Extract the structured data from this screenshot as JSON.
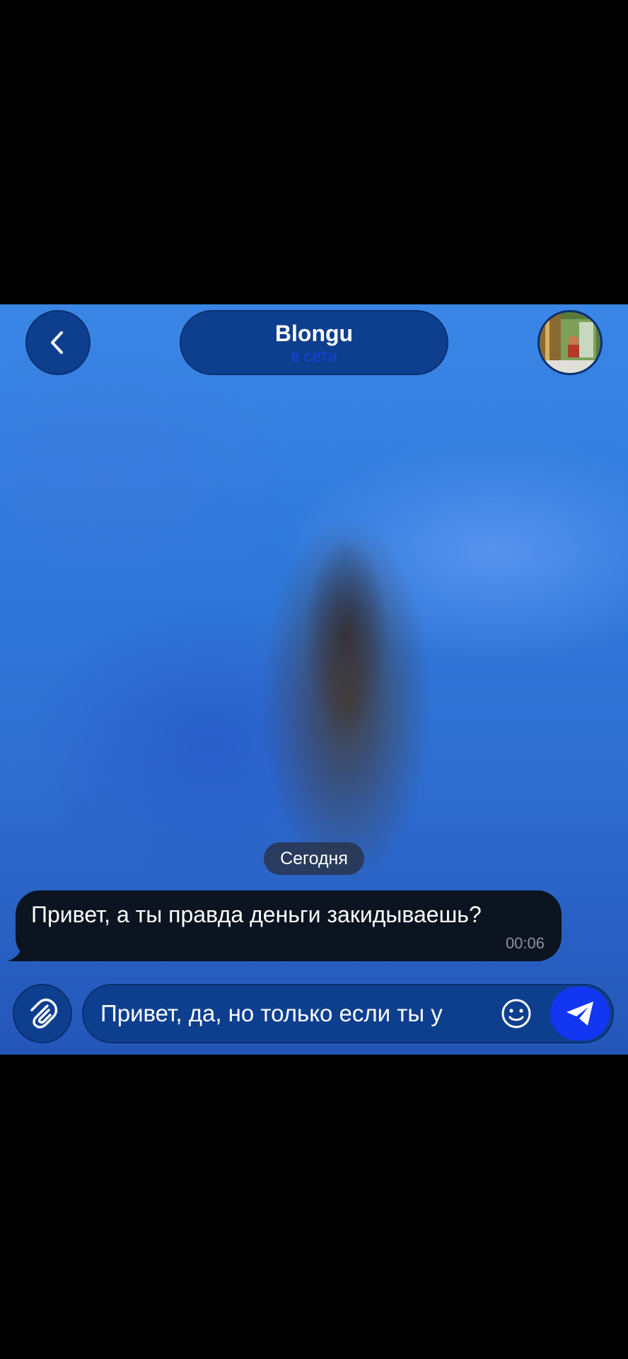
{
  "header": {
    "contact_name": "Blongu",
    "contact_status": "в сети"
  },
  "chat": {
    "date_separator": "Сегодня",
    "messages": [
      {
        "text": "Привет, а ты правда деньги закидываешь?",
        "time": "00:06",
        "direction": "incoming"
      }
    ]
  },
  "composer": {
    "input_value": "Привет, да, но только если ты у"
  },
  "icons": {
    "back": "chevron-left-icon",
    "attach": "paperclip-icon",
    "emoji": "smiley-icon",
    "send": "paper-plane-icon"
  },
  "colors": {
    "control_bg": "#0e3f8f",
    "status_accent": "#1a3fe0",
    "send_button": "#1236f2",
    "bubble_bg": "#0b1420"
  }
}
